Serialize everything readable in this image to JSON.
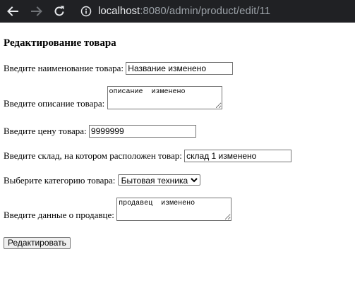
{
  "browser": {
    "url_host": "localhost",
    "url_rest": ":8080/admin/product/edit/11"
  },
  "form": {
    "title": "Редактирование товара",
    "name_label": "Введите наименование товара:",
    "name_value": "Название изменено",
    "description_label": "Введите описание товара:",
    "description_value": "описание  изменено",
    "price_label": "Введите цену товара:",
    "price_value": "9999999",
    "warehouse_label": "Введите склад, на котором расположен товар:",
    "warehouse_value": "склад 1 изменено",
    "category_label": "Выберите категорию товара:",
    "category_selected": "Бытовая техника",
    "seller_label": "Введите данные о продавце:",
    "seller_value": "продавец  изменено",
    "submit_label": "Редактировать"
  }
}
